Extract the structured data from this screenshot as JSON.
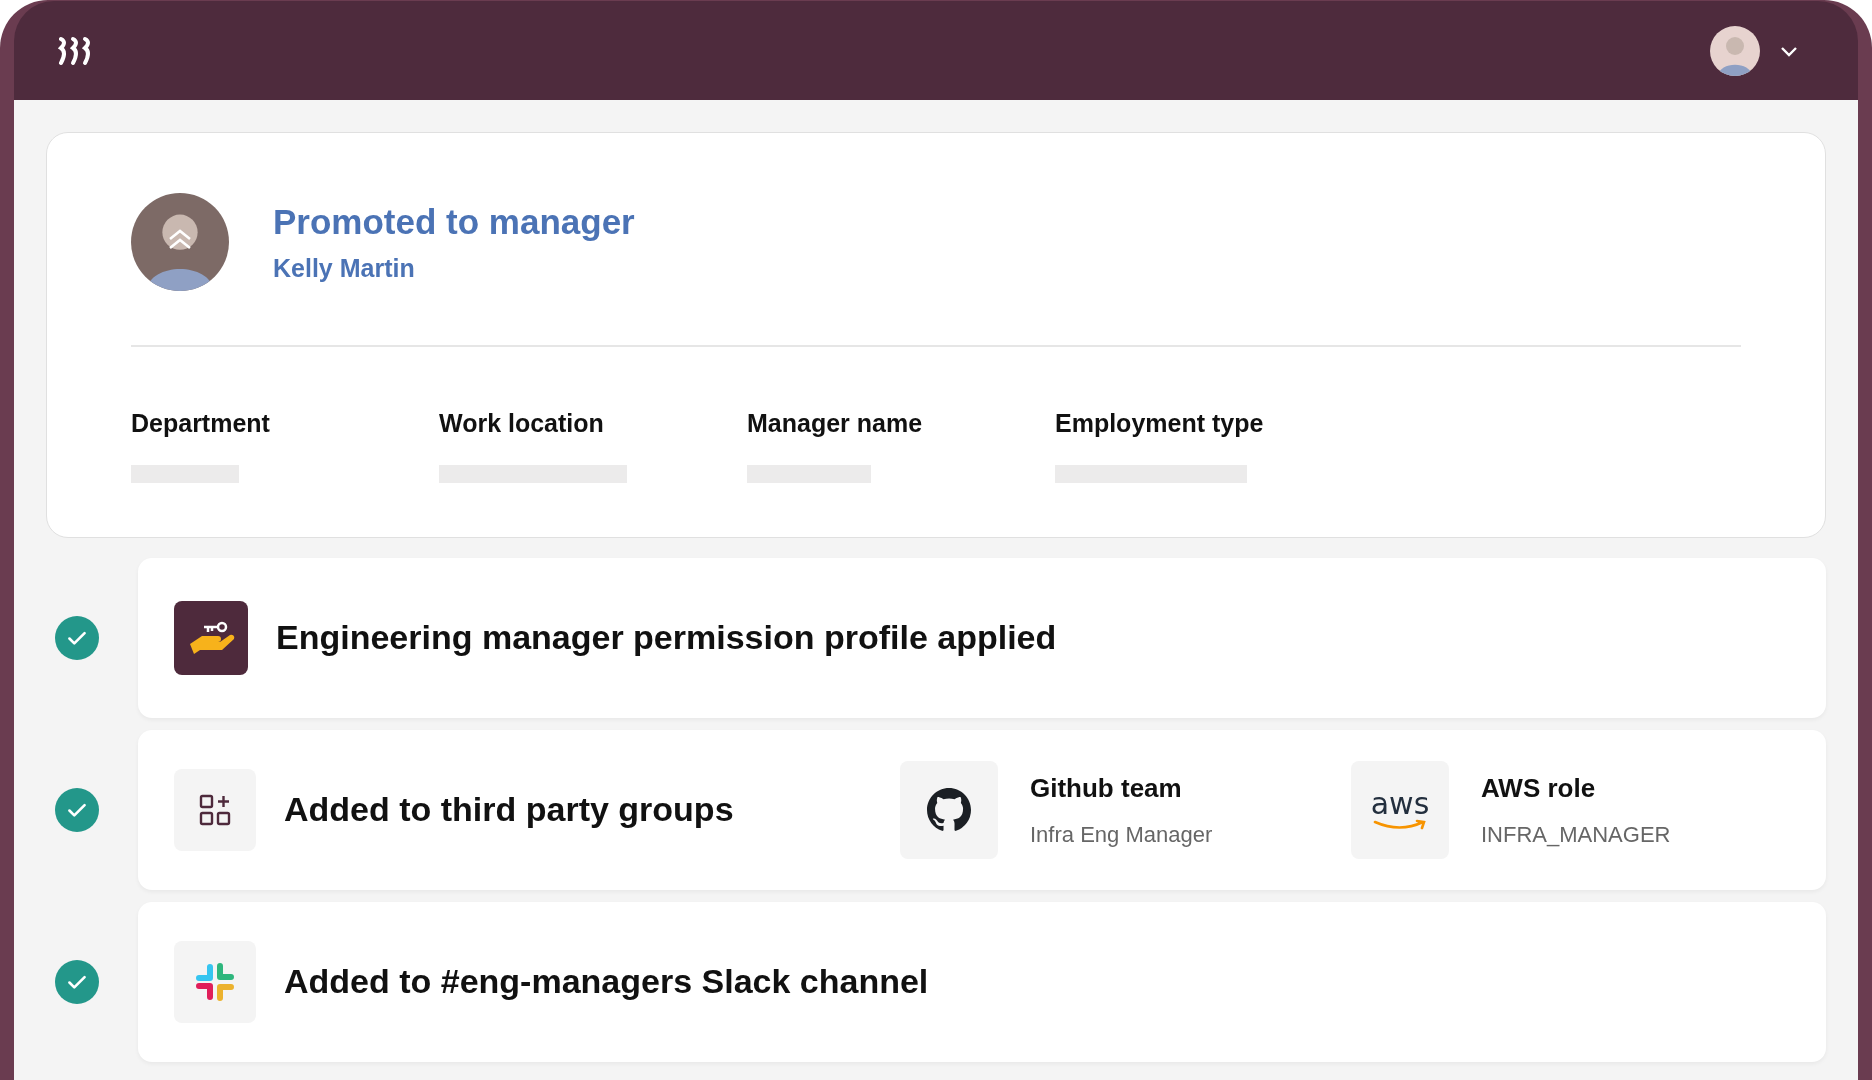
{
  "event": {
    "title": "Promoted to manager",
    "person": "Kelly Martin",
    "fields": [
      {
        "label": "Department"
      },
      {
        "label": "Work location"
      },
      {
        "label": "Manager name"
      },
      {
        "label": "Employment type"
      }
    ]
  },
  "tasks": [
    {
      "kind": "permission",
      "done": true,
      "text": "Engineering manager permission profile applied"
    },
    {
      "kind": "groups",
      "done": true,
      "text": "Added to third party groups",
      "apps": [
        {
          "kind": "github",
          "name": "Github team",
          "value": "Infra Eng Manager"
        },
        {
          "kind": "aws",
          "logo_text": "aws",
          "name": "AWS role",
          "value": "INFRA_MANAGER"
        }
      ]
    },
    {
      "kind": "slack",
      "done": true,
      "text": "Added to #eng-managers Slack channel"
    }
  ]
}
